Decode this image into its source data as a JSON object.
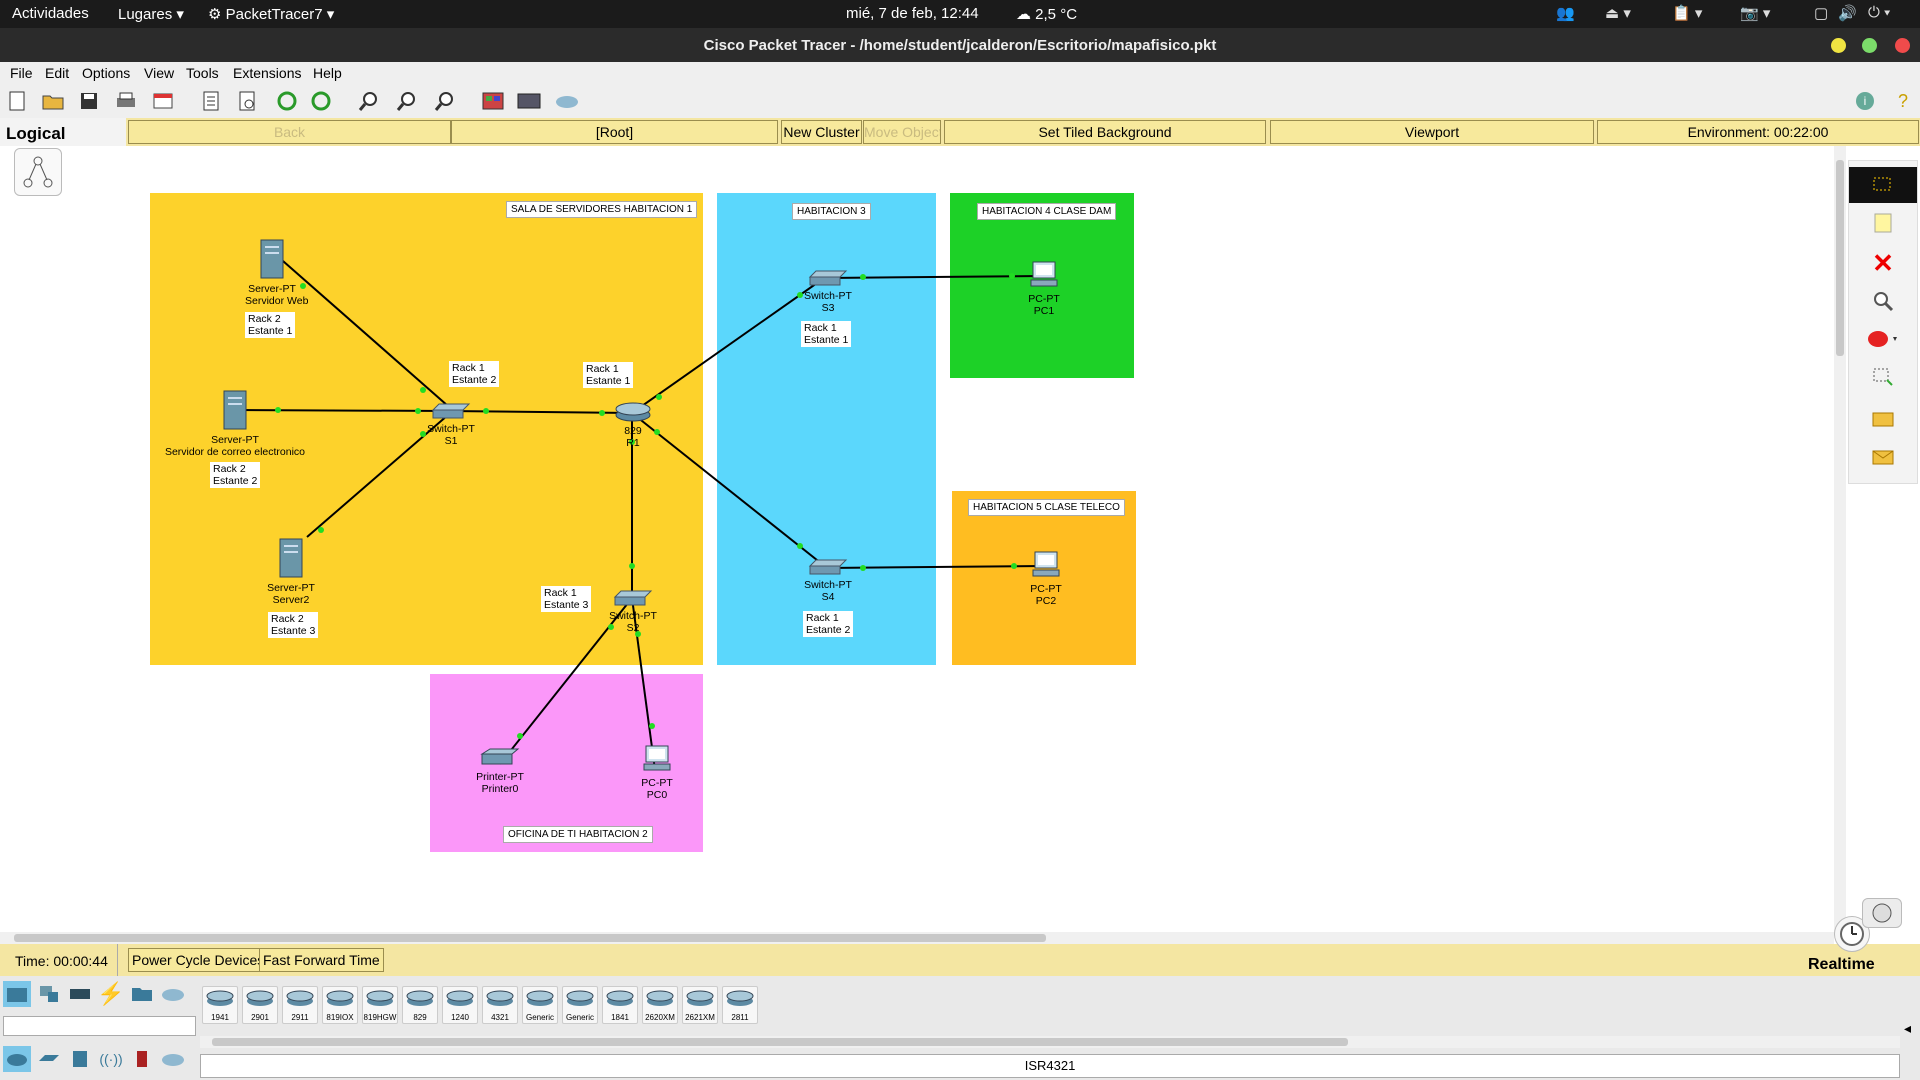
{
  "topbar": {
    "activities": "Actividades",
    "places": "Lugares",
    "app": "PacketTracer7",
    "clock": "mié,  7 de feb, 12:44",
    "weather": "2,5 °C"
  },
  "window": {
    "title": "Cisco Packet Tracer - /home/student/jcalderon/Escritorio/mapafisico.pkt"
  },
  "menu": [
    "File",
    "Edit",
    "Options",
    "View",
    "Tools",
    "Extensions",
    "Help"
  ],
  "toolbar": {
    "icons": [
      "new-file-icon",
      "open-folder-icon",
      "save-icon",
      "print-icon",
      "activity-wizard-icon",
      "document-icon",
      "inspect-icon",
      "undo-icon",
      "redo-icon",
      "zoom-in-icon",
      "zoom-reset-icon",
      "zoom-out-icon",
      "palette-icon",
      "custom-device-icon",
      "cloud-icon"
    ]
  },
  "nav": {
    "logical": "Logical",
    "back": "Back",
    "root": "[Root]",
    "new_cluster": "New Cluster",
    "move_object": "Move Object",
    "set_tiled_bg": "Set Tiled Background",
    "viewport": "Viewport",
    "environment": "Environment: 00:22:00"
  },
  "zones": [
    {
      "label": "SALA DE SERVIDORES HABITACION 1",
      "color": "#fdd22b"
    },
    {
      "label": "HABITACION 3",
      "color": "#5bd7fc"
    },
    {
      "label": "HABITACION 4 CLASE DAM",
      "color": "#1dd127"
    },
    {
      "label": "HABITACION 5 CLASE TELECO",
      "color": "#ffbd21"
    },
    {
      "label": "OFICINA DE TI HABITACION 2",
      "color": "#fb97f9"
    }
  ],
  "devices": {
    "server_web": {
      "type": "Server-PT",
      "name": "Servidor Web"
    },
    "server_mail": {
      "type": "Server-PT",
      "name": "Servidor de correo electronico"
    },
    "server2": {
      "type": "Server-PT",
      "name": "Server2"
    },
    "s1": {
      "type": "Switch-PT",
      "name": "S1"
    },
    "r1": {
      "type": "829",
      "name": "R1"
    },
    "s2": {
      "type": "Switch-PT",
      "name": "S2"
    },
    "s3": {
      "type": "Switch-PT",
      "name": "S3"
    },
    "s4": {
      "type": "Switch-PT",
      "name": "S4"
    },
    "pc1": {
      "type": "PC-PT",
      "name": "PC1"
    },
    "pc2": {
      "type": "PC-PT",
      "name": "PC2"
    },
    "pc0": {
      "type": "PC-PT",
      "name": "PC0"
    },
    "printer0": {
      "type": "Printer-PT",
      "name": "Printer0"
    }
  },
  "notes": {
    "n_web": "Rack 2\nEstante 1",
    "n_mail": "Rack 2\nEstante 2",
    "n_s2srv": "Rack 2\nEstante 3",
    "n_s1": "Rack 1\nEstante 2",
    "n_r1": "Rack 1\nEstante 1",
    "n_s2": "Rack 1\nEstante 3",
    "n_s3": "Rack 1\nEstante 1",
    "n_s4": "Rack 1\nEstante 2"
  },
  "status": {
    "time": "Time: 00:00:44",
    "power_cycle": "Power Cycle Devices",
    "fast_forward": "Fast Forward Time",
    "mode": "Realtime"
  },
  "device_list": [
    "1941",
    "2901",
    "2911",
    "819IOX",
    "819HGW",
    "829",
    "1240",
    "4321",
    "Generic",
    "Generic",
    "1841",
    "2620XM",
    "2621XM",
    "2811"
  ],
  "selected_device": "ISR4321",
  "colors": {
    "accent_yellow": "#f4e6a2",
    "link_dot": "#22dd22"
  }
}
